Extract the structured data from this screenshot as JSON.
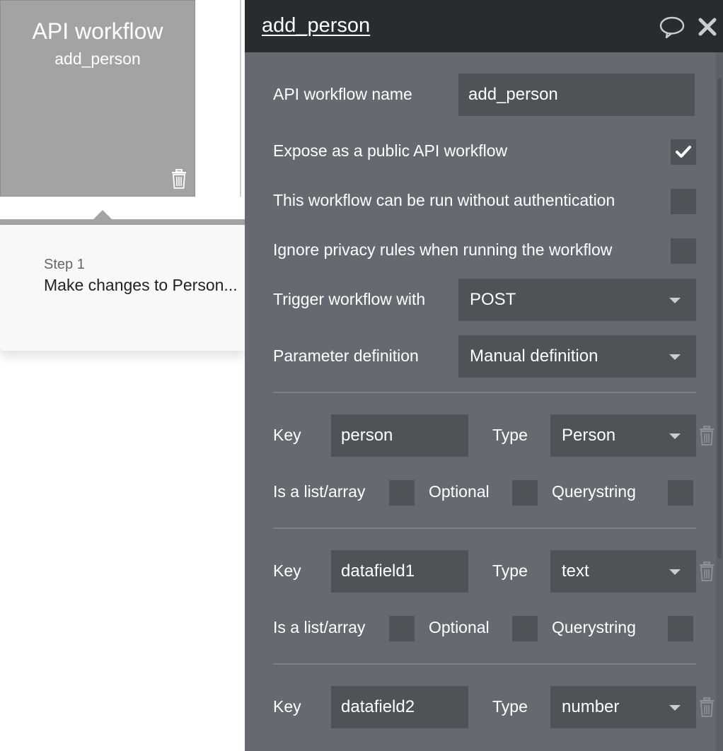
{
  "canvas": {
    "workflow_card": {
      "title": "API workflow",
      "subtitle": "add_person"
    },
    "step": {
      "number_label": "Step 1",
      "action_label": "Make changes to Person..."
    }
  },
  "panel": {
    "title": "add_person",
    "name_label": "API workflow name",
    "name_value": "add_person",
    "expose_label": "Expose as a public API workflow",
    "expose_checked": true,
    "no_auth_label": "This workflow can be run without authentication",
    "no_auth_checked": false,
    "ignore_privacy_label": "Ignore privacy rules when running the workflow",
    "ignore_privacy_checked": false,
    "trigger_label": "Trigger workflow with",
    "trigger_value": "POST",
    "param_def_label": "Parameter definition",
    "param_def_value": "Manual definition",
    "params": [
      {
        "key_label": "Key",
        "key": "person",
        "type_label": "Type",
        "type": "Person",
        "list_label": "Is a list/array",
        "optional_label": "Optional",
        "querystring_label": "Querystring"
      },
      {
        "key_label": "Key",
        "key": "datafield1",
        "type_label": "Type",
        "type": "text",
        "list_label": "Is a list/array",
        "optional_label": "Optional",
        "querystring_label": "Querystring"
      },
      {
        "key_label": "Key",
        "key": "datafield2",
        "type_label": "Type",
        "type": "number"
      }
    ]
  },
  "colors": {
    "panel_bg": "#646a6f",
    "header_bg": "#272c2f",
    "field_bg": "#4e5357",
    "card_bg": "#a3a3a3"
  },
  "icons": [
    "trash-icon",
    "comment-icon",
    "close-icon",
    "checkmark-icon",
    "chevron-down-icon"
  ]
}
